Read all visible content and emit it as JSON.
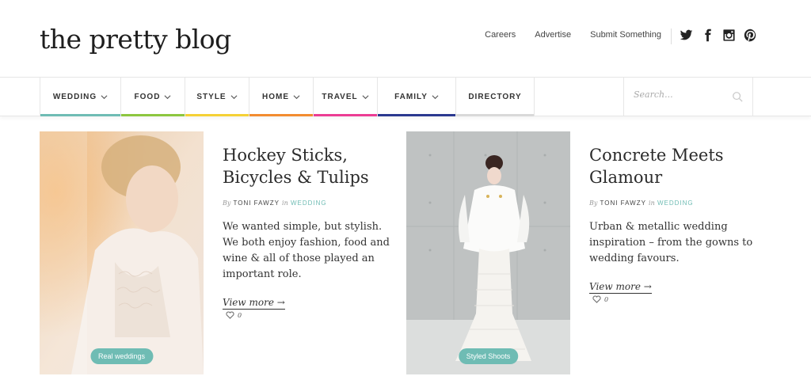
{
  "header": {
    "logo": "the pretty blog",
    "links": [
      "Careers",
      "Advertise",
      "Submit Something"
    ],
    "social": [
      "twitter-icon",
      "facebook-icon",
      "instagram-icon",
      "pinterest-icon"
    ]
  },
  "nav": {
    "items": [
      {
        "label": "WEDDING",
        "color": "#6fbcb4"
      },
      {
        "label": "FOOD",
        "color": "#8cc63f"
      },
      {
        "label": "STYLE",
        "color": "#f5d136"
      },
      {
        "label": "HOME",
        "color": "#f28b30"
      },
      {
        "label": "TRAVEL",
        "color": "#ec3d94"
      },
      {
        "label": "FAMILY",
        "color": "#2b3990"
      },
      {
        "label": "DIRECTORY",
        "color": "#d9d9d9"
      }
    ],
    "search_placeholder": "Search..."
  },
  "posts": [
    {
      "title_line1": "Hockey Sticks,",
      "title_line2": "Bicycles & Tulips",
      "by": "By",
      "author": "TONI FAWZY",
      "in": "in",
      "category": "WEDDING",
      "excerpt": "We wanted simple, but stylish. We both enjoy fashion, food and wine & all of those played an important role.",
      "view_more": "View more →",
      "likes": "0",
      "tag": "Real weddings"
    },
    {
      "title_line1": "Concrete Meets",
      "title_line2": "Glamour",
      "by": "By",
      "author": "TONI FAWZY",
      "in": "in",
      "category": "WEDDING",
      "excerpt": "Urban & metallic wedding inspiration – from the gowns to wedding favours.",
      "view_more": "View more →",
      "likes": "0",
      "tag": "Styled Shoots"
    }
  ]
}
